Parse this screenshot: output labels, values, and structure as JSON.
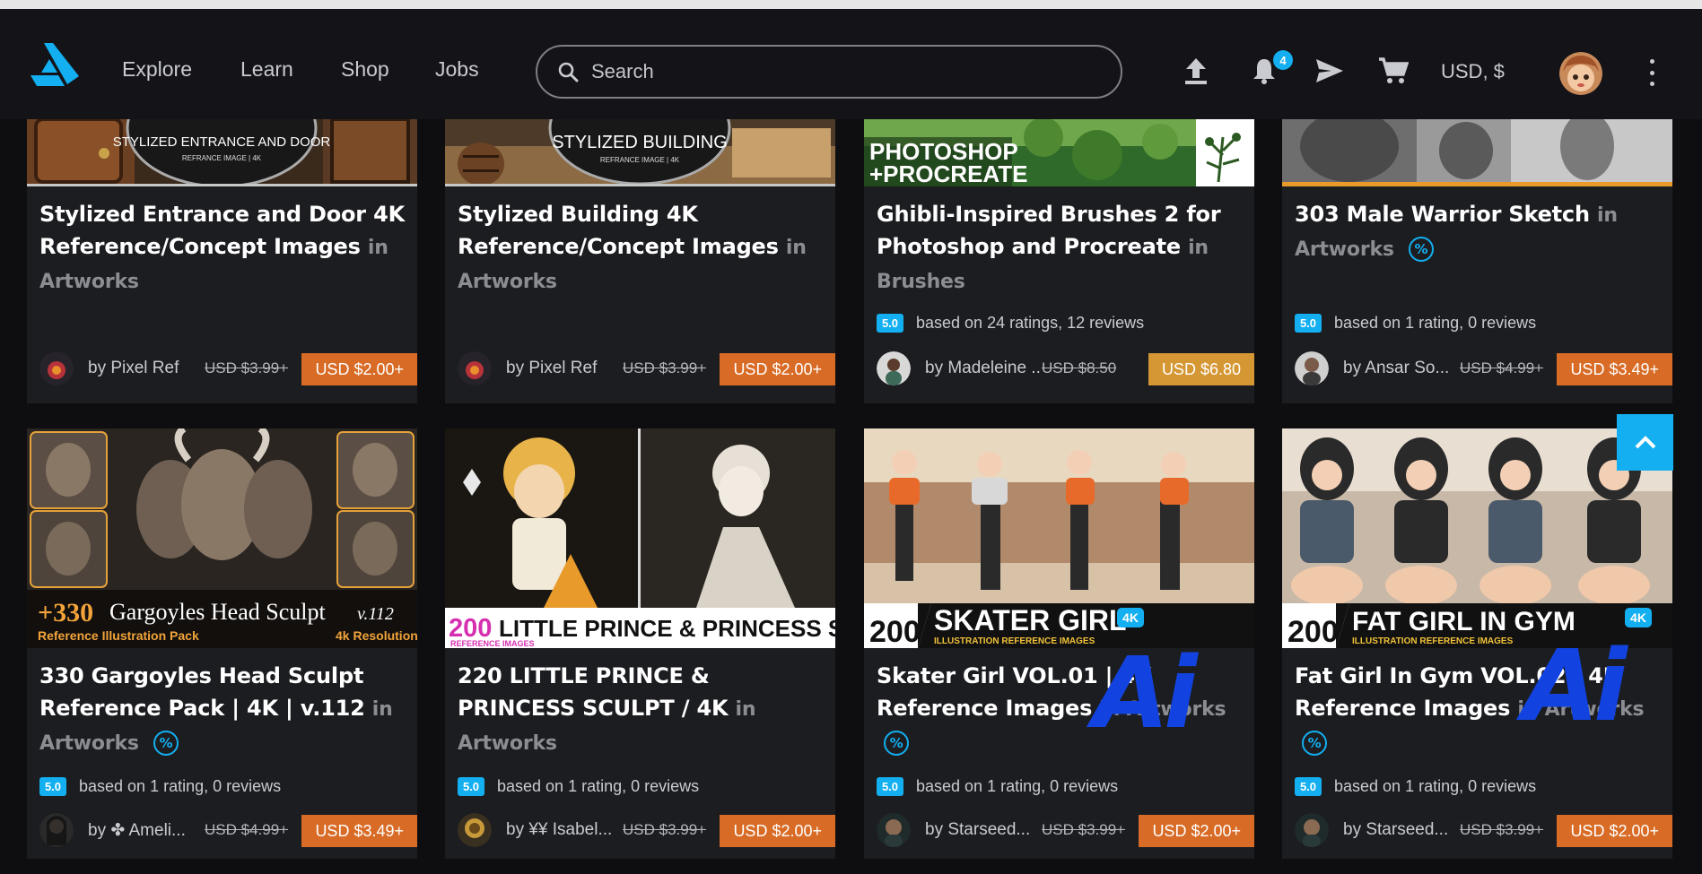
{
  "nav": {
    "links": [
      "Explore",
      "Learn",
      "Shop",
      "Jobs"
    ],
    "search_placeholder": "Search",
    "notification_count": "4",
    "currency": "USD, $"
  },
  "icons": {
    "logo": "artstation-logo-icon",
    "search": "search-icon",
    "upload": "upload-icon",
    "notifications": "bell-icon",
    "messages": "send-icon",
    "cart": "cart-icon",
    "more": "kebab-menu-icon",
    "scroll_top": "chevron-up-icon",
    "discount": "percent-icon"
  },
  "colors": {
    "accent": "#13aff0",
    "price": "#d86b25",
    "price_sale": "#d59733",
    "card": "#1c1d21"
  },
  "cards": [
    {
      "thumb_text": [
        "STYLIZED ENTRANCE AND DOOR",
        "REFRANCE IMAGE | 4K"
      ],
      "title": "Stylized Entrance and Door 4K Reference/Concept Images",
      "category": "in Artworks",
      "rating": "",
      "rating_text": "",
      "seller": "by Pixel Ref",
      "old_price": "USD $3.99+",
      "price": "USD $2.00+"
    },
    {
      "thumb_text": [
        "STYLIZED BUILDING",
        "REFRANCE IMAGE | 4K"
      ],
      "title": "Stylized Building 4K Reference/Concept Images",
      "category": "in Artworks",
      "rating": "",
      "rating_text": "",
      "seller": "by Pixel Ref",
      "old_price": "USD $3.99+",
      "price": "USD $2.00+"
    },
    {
      "thumb_text": [
        "PHOTOSHOP",
        "+PROCREATE"
      ],
      "title": "Ghibli-Inspired Brushes 2 for Photoshop and Procreate",
      "category": "in Brushes",
      "rating": "5.0",
      "rating_text": "based on 24 ratings, 12 reviews",
      "seller": "by Madeleine ...",
      "old_price": "USD $8.50",
      "price": "USD $6.80"
    },
    {
      "thumb_text": [],
      "title": "303 Male Warrior Sketch",
      "category": "in Artworks",
      "rating": "5.0",
      "rating_text": "based on 1 rating, 0 reviews",
      "seller": "by Ansar So...",
      "old_price": "USD $4.99+",
      "price": "USD $3.49+"
    },
    {
      "thumb_text": [
        "+330",
        "Gargoyles Head Sculpt",
        "v.112",
        "Reference Illustration Pack",
        "4k Resolution"
      ],
      "title": "330 Gargoyles Head Sculpt Reference Pack | 4K | v.112",
      "category": "in Artworks",
      "rating": "5.0",
      "rating_text": "based on 1 rating, 0 reviews",
      "seller": "by ✤ Ameli...",
      "old_price": "USD $4.99+",
      "price": "USD $3.49+"
    },
    {
      "thumb_text": [
        "200",
        "LITTLE PRINCE & PRINCESS SCULPT",
        "REFERENCE IMAGES"
      ],
      "title": "220 LITTLE PRINCE & PRINCESS SCULPT / 4K",
      "category": "in Artworks",
      "rating": "5.0",
      "rating_text": "based on 1 rating, 0 reviews",
      "seller": "by ¥¥ Isabel...",
      "old_price": "USD $3.99+",
      "price": "USD $2.00+"
    },
    {
      "thumb_text": [
        "200",
        "SKATER GIRL",
        "4K",
        "ILLUSTRATION REFERENCE IMAGES"
      ],
      "title": "Skater Girl VOL.01 | 4K Reference Images",
      "category": "in Artworks",
      "rating": "5.0",
      "rating_text": "based on 1 rating, 0 reviews",
      "seller": "by Starseed...",
      "old_price": "USD $3.99+",
      "price": "USD $2.00+",
      "overlay": "Ai"
    },
    {
      "thumb_text": [
        "200",
        "FAT GIRL IN GYM",
        "4K",
        "ILLUSTRATION REFERENCE IMAGES"
      ],
      "title": "Fat Girl In Gym VOL.02 | 4K Reference Images",
      "category": "in Artworks",
      "rating": "5.0",
      "rating_text": "based on 1 rating, 0 reviews",
      "seller": "by Starseed...",
      "old_price": "USD $3.99+",
      "price": "USD $2.00+",
      "overlay": "Ai"
    }
  ]
}
